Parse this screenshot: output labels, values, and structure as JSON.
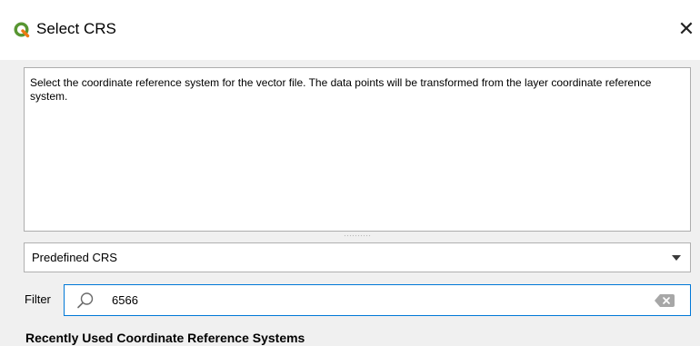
{
  "window": {
    "title": "Select CRS",
    "close_symbol": "✕"
  },
  "description": "Select the coordinate reference system for the vector file. The data points will be transformed from the layer coordinate reference system.",
  "crs_select": {
    "selected": "Predefined CRS"
  },
  "filter": {
    "label": "Filter",
    "value": "6566"
  },
  "recent_section": {
    "heading": "Recently Used Coordinate Reference Systems"
  },
  "icons": {
    "app": "qgis-logo-icon",
    "search": "search-icon",
    "clear": "clear-icon",
    "dropdown": "chevron-down-icon"
  },
  "colors": {
    "focus_border": "#0078d7",
    "logo_green": "#589632",
    "logo_yellow": "#ee7913"
  }
}
